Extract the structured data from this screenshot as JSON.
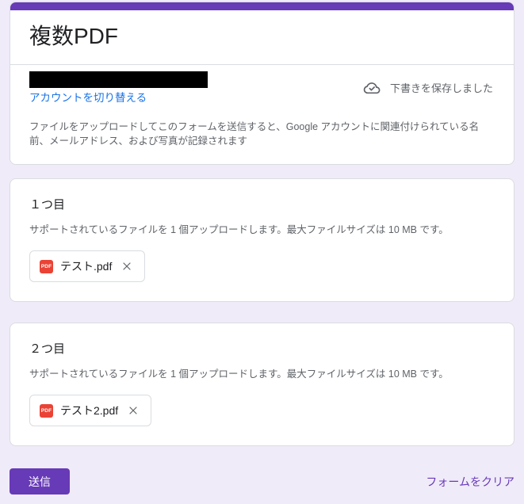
{
  "theme": {
    "primary_color": "#673ab7",
    "background_color": "#f0ebf8",
    "card_border_color": "#dadce0",
    "text_color": "#202124",
    "muted_text_color": "#5f6368",
    "link_blue_color": "#1a73e8",
    "pdf_badge_color": "#ea4335"
  },
  "header": {
    "title": "複数PDF",
    "account": {
      "switch_account_label": "アカウントを切り替える",
      "draft_status": "下書きを保存しました",
      "notice": "ファイルをアップロードしてこのフォームを送信すると、Google アカウントに関連付けられている名前、メールアドレス、および写真が記録されます"
    }
  },
  "questions": [
    {
      "title": "１つ目",
      "description": "サポートされているファイルを 1 個アップロードします。最大ファイルサイズは 10 MB です。",
      "file": {
        "name": "テスト.pdf",
        "type_label": "PDF"
      }
    },
    {
      "title": "２つ目",
      "description": "サポートされているファイルを 1 個アップロードします。最大ファイルサイズは 10 MB です。",
      "file": {
        "name": "テスト2.pdf",
        "type_label": "PDF"
      }
    }
  ],
  "footer": {
    "submit_label": "送信",
    "clear_form_label": "フォームをクリア"
  }
}
